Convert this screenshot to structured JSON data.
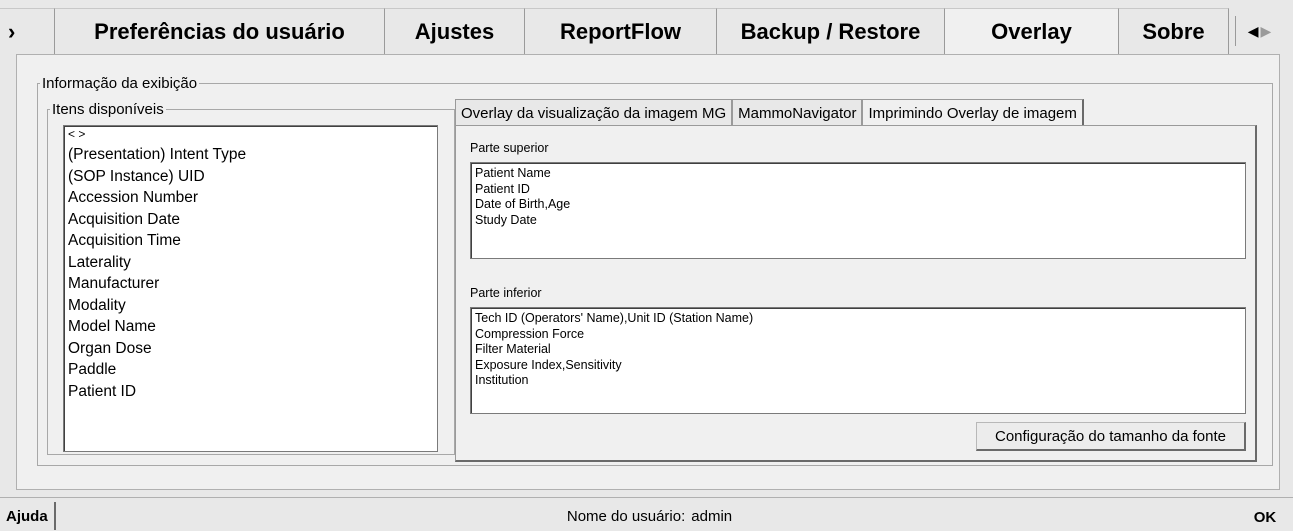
{
  "tabs": [
    {
      "label": "›",
      "stub": true
    },
    {
      "label": "Preferências do usuário"
    },
    {
      "label": "Ajustes"
    },
    {
      "label": "ReportFlow"
    },
    {
      "label": "Backup / Restore"
    },
    {
      "label": "Overlay",
      "active": true
    },
    {
      "label": "Sobre"
    }
  ],
  "tab_scroll": {
    "left_icon": "◀",
    "right_icon": "▶"
  },
  "panel": {
    "info_legend": "Informação da exibição",
    "available_legend": "Itens disponíveis",
    "available_items": [
      "< >",
      "(Presentation) Intent Type",
      "(SOP Instance) UID",
      "Accession Number",
      "Acquisition Date",
      "Acquisition Time",
      "Laterality",
      "Manufacturer",
      "Modality",
      "Model Name",
      "Organ Dose",
      "Paddle",
      "Patient ID"
    ],
    "inner_tabs": [
      {
        "label": "Overlay da visualização da imagem MG"
      },
      {
        "label": "MammoNavigator"
      },
      {
        "label": "Imprimindo Overlay de imagem",
        "active": true
      }
    ],
    "upper_label": "Parte superior",
    "upper_items": [
      "Patient Name",
      "Patient ID",
      "Date of Birth,Age",
      "Study Date"
    ],
    "lower_label": "Parte inferior",
    "lower_items": [
      "Tech ID (Operators' Name),Unit ID (Station Name)",
      "Compression Force",
      "Filter Material",
      "Exposure Index,Sensitivity",
      "Institution"
    ],
    "font_button": "Configuração do tamanho da fonte"
  },
  "status": {
    "help_label": "Ajuda",
    "user_label": "Nome do usuário:",
    "user_value": "admin",
    "ok_label": "OK"
  }
}
